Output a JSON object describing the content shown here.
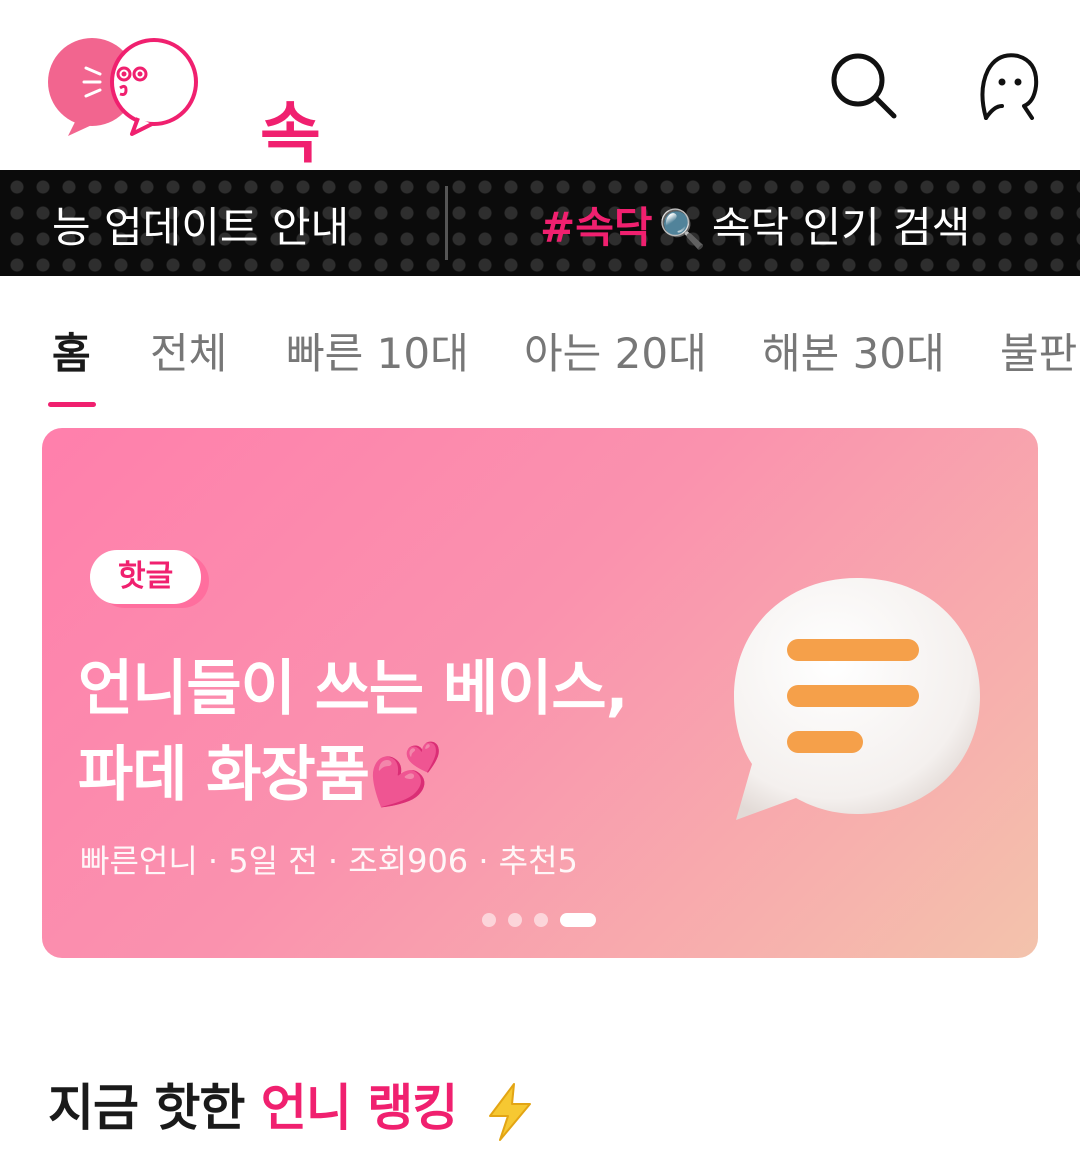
{
  "app": {
    "logo_text": "속닥"
  },
  "header": {
    "search_icon": "search-icon",
    "profile_icon": "profile-icon"
  },
  "ticker": {
    "left_text": "능 업데이트 안내",
    "tag": "#속닥",
    "emoji": "🔍",
    "right_text": "속닥 인기 검색"
  },
  "tabs": [
    {
      "label": "홈",
      "active": true
    },
    {
      "label": "전체"
    },
    {
      "label": "빠른 10대"
    },
    {
      "label": "아는 20대"
    },
    {
      "label": "해본 30대"
    },
    {
      "label": "불판"
    }
  ],
  "banner": {
    "badge": "핫글",
    "title": "언니들이 쓰는 베이스, 파데 화장품💕",
    "meta": "빠른언니 · 5일 전 · 조회906 · 추천5",
    "page_count": 4,
    "current_page": 4
  },
  "section": {
    "title_plain": "지금 핫한 ",
    "title_accent": "언니 랭킹"
  },
  "colors": {
    "brand": "#f0206f",
    "ticker_bg": "#0b0b0b",
    "bubble_lines": "#f5a04a"
  }
}
